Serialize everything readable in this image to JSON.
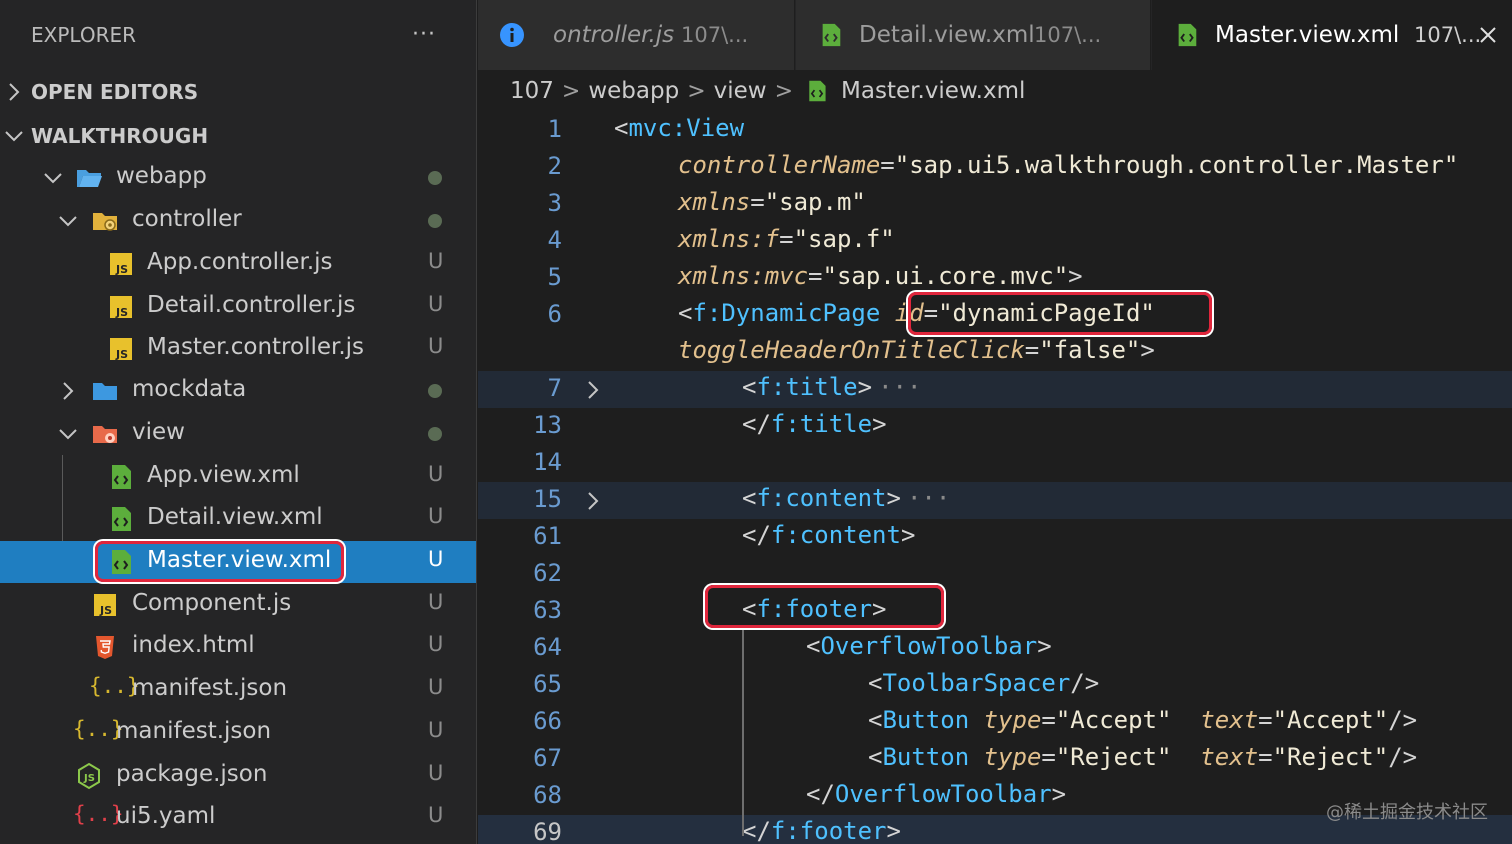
{
  "sidebar": {
    "header": "EXPLORER",
    "more": "···",
    "open_editors": "OPEN EDITORS",
    "workspace": "WALKTHROUGH",
    "items": [
      {
        "name": "webapp",
        "status": ""
      },
      {
        "name": "controller",
        "status": ""
      },
      {
        "name": "App.controller.js",
        "status": "U"
      },
      {
        "name": "Detail.controller.js",
        "status": "U"
      },
      {
        "name": "Master.controller.js",
        "status": "U"
      },
      {
        "name": "mockdata",
        "status": ""
      },
      {
        "name": "view",
        "status": ""
      },
      {
        "name": "App.view.xml",
        "status": "U"
      },
      {
        "name": "Detail.view.xml",
        "status": "U"
      },
      {
        "name": "Master.view.xml",
        "status": "U"
      },
      {
        "name": "Component.js",
        "status": "U"
      },
      {
        "name": "index.html",
        "status": "U"
      },
      {
        "name": "manifest.json",
        "status": "U"
      },
      {
        "name": "manifest.json",
        "status": "U"
      },
      {
        "name": "package.json",
        "status": "U"
      },
      {
        "name": "ui5.yaml",
        "status": "U"
      }
    ]
  },
  "tabs": [
    {
      "label": "ontroller.js",
      "sub": "107\\..."
    },
    {
      "label": "Detail.view.xml",
      "sub": "107\\..."
    },
    {
      "label": "Master.view.xml",
      "sub": "107\\..."
    }
  ],
  "breadcrumb": [
    "107",
    "webapp",
    "view",
    "Master.view.xml"
  ],
  "editor": {
    "line_numbers": [
      "1",
      "2",
      "3",
      "4",
      "5",
      "6",
      "",
      "7",
      "13",
      "14",
      "15",
      "61",
      "62",
      "63",
      "64",
      "65",
      "66",
      "67",
      "68",
      "69"
    ],
    "tokens": {
      "t1": "mvc:View",
      "a2": "controllerName",
      "s2": "\"sap.ui5.walkthrough.controller.Master\"",
      "a3": "xmlns",
      "s3": "\"sap.m\"",
      "a4": "xmlns:f",
      "s4": "\"sap.f\"",
      "a5": "xmlns:mvc",
      "s5": "\"sap.ui.core.mvc\"",
      "t6": "f:DynamicPage",
      "a6": "id",
      "s6": "\"dynamicPageId\"",
      "a6b": "toggleHeaderOnTitleClick",
      "s6b": "\"false\"",
      "t7": "f:title",
      "t13": "f:title",
      "t15": "f:content",
      "t61": "f:content",
      "t63": "f:footer",
      "t64": "OverflowToolbar",
      "t65": "ToolbarSpacer",
      "t66": "Button",
      "a66": "type",
      "s66": "\"Accept\"",
      "a66b": "text",
      "s66b": "\"Accept\"",
      "t67": "Button",
      "a67": "type",
      "s67": "\"Reject\"",
      "a67b": "text",
      "s67b": "\"Reject\"",
      "t68": "OverflowToolbar",
      "t69": "f:footer"
    },
    "ellipsis": "···"
  },
  "watermark": "@稀土掘金技术社区",
  "colors": {
    "selection": "#1f7ec1",
    "highlight": "#e0263c",
    "tag": "#4fc1ff",
    "attr": "#e2c08d"
  }
}
